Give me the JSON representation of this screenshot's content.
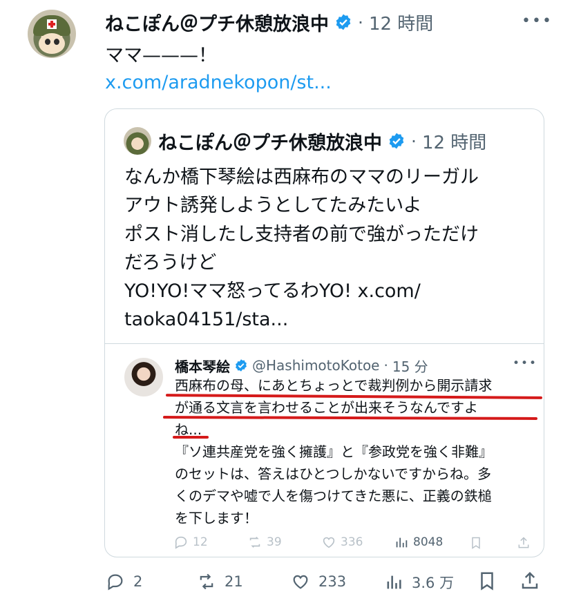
{
  "tweet": {
    "author_name": "ねこぽん＠プチ休憩放浪中",
    "separator": "·",
    "time": "12 時間",
    "text": "ママ———！",
    "link": "x.com/aradnekopon/st..."
  },
  "quoted": {
    "author_name": "ねこぽん＠プチ休憩放浪中",
    "separator": "·",
    "time": "12 時間",
    "lines": [
      "なんか橋下琴絵は西麻布のママのリーガル",
      "アウト誘発しようとしてたみたいよ",
      "ポスト消したし支持者の前で強がっただけ",
      "だろうけど",
      "YO!YO!ママ怒ってるわYO! x.com/",
      "taoka04151/sta..."
    ]
  },
  "embedded": {
    "author_name": "橋本琴絵",
    "handle": "@HashimotoKotoe",
    "separator": "·",
    "time": "15 分",
    "lines": [
      "西麻布の母、にあとちょっとで裁判例から開示請求",
      "が通る文言を言わせることが出来そうなんですよ",
      "ね...",
      "『ソ連共産党を強く擁護』と『参政党を強く非難』",
      "のセットは、答えはひとつしかないですからね。多",
      "くのデマや嘘で人を傷つけてきた悪に、正義の鉄槌",
      "を下します！"
    ],
    "replies": "12",
    "reposts": "39",
    "likes": "336",
    "views": "8048"
  },
  "actions": {
    "replies": "2",
    "reposts": "21",
    "likes": "233",
    "views": "3.6 万"
  },
  "colors": {
    "verified": "#1d9bf0",
    "text": "#0f1419",
    "secondary": "#536471",
    "link": "#1d9bf0",
    "annotation": "#d51a1a"
  },
  "icons": [
    "more-icon",
    "verified-icon",
    "reply-icon",
    "repost-icon",
    "like-icon",
    "views-icon",
    "bookmark-icon",
    "share-icon"
  ]
}
